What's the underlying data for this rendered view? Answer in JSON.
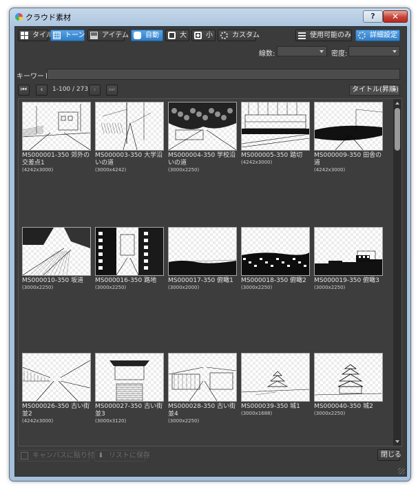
{
  "window": {
    "title": "クラウド素材",
    "help_label": "?",
    "close_label": "✕"
  },
  "toolbar": {
    "view_tabs": [
      {
        "label": "タイル",
        "icon": "tile-icon",
        "active": false
      },
      {
        "label": "トーン",
        "icon": "tone-icon",
        "active": true
      },
      {
        "label": "アイテム",
        "icon": "item-icon",
        "active": false
      }
    ],
    "size_tabs": [
      {
        "label": "自動",
        "active": true
      },
      {
        "label": "大",
        "active": false
      },
      {
        "label": "小",
        "active": false
      },
      {
        "label": "カスタム",
        "active": false
      }
    ],
    "available_only_label": "使用可能のみ",
    "advanced_label": "詳細設定"
  },
  "filters": {
    "line_count_label": "線数:",
    "line_count_value": "",
    "density_label": "密度:",
    "density_value": "",
    "keyword_label": "キーワード",
    "keyword_value": ""
  },
  "pager": {
    "first": "⏮",
    "prev": "‹",
    "range": "1-100 / 273",
    "next": "›",
    "last": "⏭",
    "sort_value": "タイトル(昇順)"
  },
  "items": [
    {
      "title": "MS000001-350 郊外の交差点1",
      "size": "(4242x3000)"
    },
    {
      "title": "MS000003-350 大学沿いの道",
      "size": "(3000x4242)"
    },
    {
      "title": "MS000004-350 学校沿いの道",
      "size": "(3000x2250)"
    },
    {
      "title": "MS000005-350 踏切",
      "size": "(4242x3000)"
    },
    {
      "title": "MS000009-350 田舎の道",
      "size": "(4242x3000)"
    },
    {
      "title": "MS000010-350 坂道",
      "size": "(3000x2250)"
    },
    {
      "title": "MS000016-350 路地",
      "size": "(3000x2250)"
    },
    {
      "title": "MS000017-350 俯瞰1",
      "size": "(3000x2000)"
    },
    {
      "title": "MS000018-350 俯瞰2",
      "size": "(3000x2250)"
    },
    {
      "title": "MS000019-350 俯瞰3",
      "size": "(3000x2250)"
    },
    {
      "title": "MS000026-350 古い街並2",
      "size": "(4242x3000)"
    },
    {
      "title": "MS000027-350 古い街並3",
      "size": "(3000x3120)"
    },
    {
      "title": "MS000028-350 古い街並4",
      "size": "(3000x2250)"
    },
    {
      "title": "MS000039-350 城1",
      "size": "(3000x1688)"
    },
    {
      "title": "MS000040-350 城2",
      "size": "(3000x2250)"
    }
  ],
  "footer": {
    "paste_label": "キャンバスに貼り付け",
    "save_label": "リストに保存",
    "close_label": "閉じる"
  }
}
